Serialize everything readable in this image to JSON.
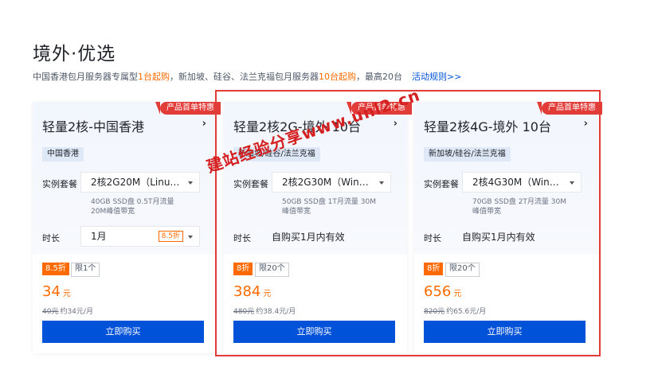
{
  "header": {
    "title": "境外·优选",
    "subtitle_parts": [
      "中国香港包月服务器专属型",
      "1台起购",
      "，新加坡、硅谷、法兰克福包月服务器",
      "10台起购",
      "，最高20台"
    ],
    "rules_link": "活动规则>>"
  },
  "cards": [
    {
      "ribbon": "产品首单特惠",
      "title": "轻量2核-中国香港",
      "region": "中国香港",
      "package_label": "实例套餐",
      "package_value": "2核2G20M（Linu…",
      "spec_line1": "40GB SSD盘 0.5T月流量",
      "spec_line2": "20M峰值带宽",
      "duration_label": "时长",
      "duration_value": "1月",
      "duration_discount": "8.5折",
      "discount_badge": "8.5折",
      "limit_badge": "限1个",
      "price": "34",
      "price_unit": "元",
      "orig_price": "40元",
      "monthly": "约34元/月",
      "buy_label": "立即购买"
    },
    {
      "ribbon": "产品首单特惠",
      "title": "轻量2核2G-境外 10台",
      "region": "新加坡/硅谷/法兰克福",
      "package_label": "实例套餐",
      "package_value": "2核2G30M（Win…",
      "spec_line1": "50GB SSD盘 1T月流量 30M",
      "spec_line2": "峰值带宽",
      "duration_label": "时长",
      "duration_value": "自购买1月内有效",
      "discount_badge": "8折",
      "limit_badge": "限20个",
      "price": "384",
      "price_unit": "元",
      "orig_price": "480元",
      "monthly": "约38.4元/月",
      "buy_label": "立即购买"
    },
    {
      "ribbon": "产品首单特惠",
      "title": "轻量2核4G-境外 10台",
      "region": "新加坡/硅谷/法兰克福",
      "package_label": "实例套餐",
      "package_value": "2核4G30M（Win…",
      "spec_line1": "70GB SSD盘 2T月流量 30M",
      "spec_line2": "峰值带宽",
      "duration_label": "时长",
      "duration_value": "自购买1月内有效",
      "discount_badge": "8折",
      "limit_badge": "限20个",
      "price": "656",
      "price_unit": "元",
      "orig_price": "820元",
      "monthly": "约65.6元/月",
      "buy_label": "立即购买"
    }
  ],
  "watermark": "建站经验分享www.unl2.cn",
  "colors": {
    "accent_orange": "#ff6a00",
    "primary_blue": "#0052d9",
    "ribbon_red": "#e23c39",
    "highlight_red": "#e23c39"
  }
}
